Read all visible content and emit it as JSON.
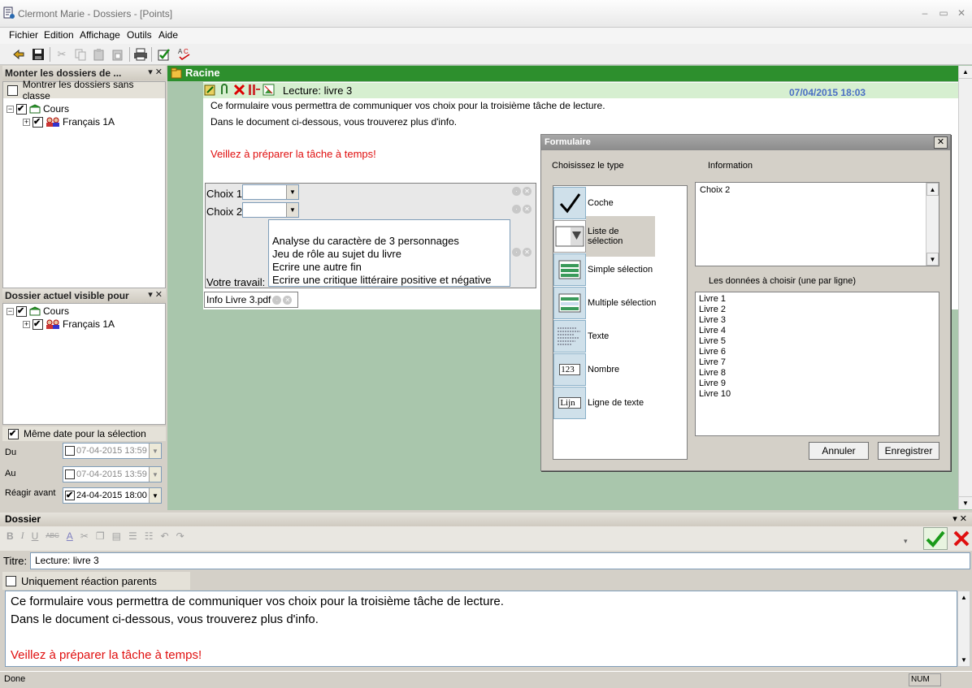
{
  "window": {
    "title": "Clermont Marie - Dossiers - [Points]"
  },
  "menu": [
    "Fichier",
    "Edition",
    "Affichage",
    "Outils",
    "Aide"
  ],
  "left_panel_top": {
    "title": "Monter les dossiers de ...",
    "show_unclassified": "Montrer les dossiers sans classe",
    "tree": [
      {
        "label": "Cours"
      },
      {
        "label": "Français 1A"
      }
    ]
  },
  "left_panel_bottom": {
    "title": "Dossier actuel visible pour",
    "tree": [
      {
        "label": "Cours"
      },
      {
        "label": "Français 1A"
      }
    ]
  },
  "dates": {
    "same_date_label": "Même date pour la sélection",
    "du_label": "Du",
    "du_value": "07-04-2015 13:59",
    "au_label": "Au",
    "au_value": "07-04-2015 13:59",
    "reagir_label": "Réagir avant",
    "reagir_value": "24-04-2015 18:00"
  },
  "main": {
    "racine_label": "Racine",
    "doc_title": "Lecture: livre 3",
    "doc_date": "07/04/2015 18:03",
    "line1": "Ce formulaire vous permettra de communiquer vos choix pour la troisième tâche de lecture.",
    "line2": "Dans le document ci-dessous, vous trouverez plus d'info.",
    "warning": "Veillez à préparer la tâche à temps!",
    "choix1": "Choix 1",
    "choix2": "Choix 2",
    "votre_travail": "Votre travail:",
    "travail_options": [
      "Analyse du caractère de 3 personnages",
      "Jeu de rôle au sujet du livre",
      "Ecrire une autre fin",
      "Ecrire une critique littéraire positive et négative"
    ],
    "attachment": "Info Livre 3.pdf"
  },
  "dialog": {
    "title": "Formulaire",
    "type_label": "Choisissez le type",
    "info_label": "Information",
    "types": [
      {
        "label": "Coche",
        "icon": "checkmark-icon"
      },
      {
        "label": "Liste de sélection",
        "icon": "dropdown-list-icon"
      },
      {
        "label": "Simple sélection",
        "icon": "single-select-icon"
      },
      {
        "label": "Multiple sélection",
        "icon": "multi-select-icon"
      },
      {
        "label": "Texte",
        "icon": "text-icon"
      },
      {
        "label": "Nombre",
        "icon": "number-icon"
      },
      {
        "label": "Ligne de texte",
        "icon": "text-line-icon"
      }
    ],
    "selected_type": "Liste de sélection",
    "info_value": "Choix 2",
    "data_label": "Les données à choisir (une par ligne)",
    "data_items": [
      "Livre 1",
      "Livre 2",
      "Livre 3",
      "Livre 4",
      "Livre 5",
      "Livre 6",
      "Livre 7",
      "Livre 8",
      "Livre 9",
      "Livre 10"
    ],
    "annuler": "Annuler",
    "enregistrer": "Enregistrer",
    "number_sample": "123",
    "text_line_sample": "Lijn"
  },
  "dossier": {
    "header": "Dossier",
    "titre_label": "Titre:",
    "titre_value": "Lecture: livre 3",
    "parents_only": "Uniquement réaction parents",
    "body_line1": "Ce formulaire vous permettra de communiquer vos choix pour la troisième tâche de lecture.",
    "body_line2": "Dans le document ci-dessous, vous trouverez plus d'info.",
    "body_warning": "Veillez à préparer la tâche à temps!"
  },
  "status": {
    "text": "Done",
    "num": "NUM"
  },
  "colors": {
    "green_bar": "#2d8f2d",
    "main_bg": "#a9c6ac",
    "warning_red": "#e01010",
    "date_blue": "#4a6fc4"
  }
}
